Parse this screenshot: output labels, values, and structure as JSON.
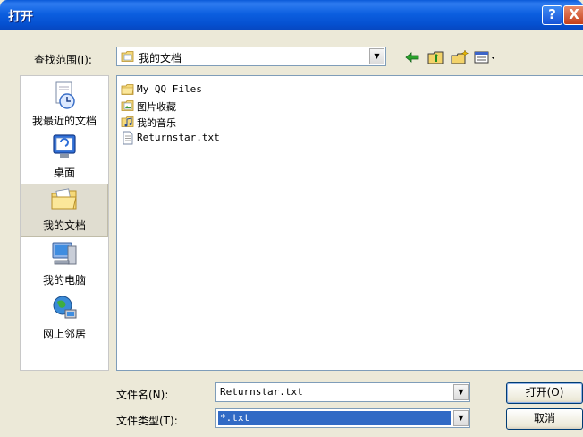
{
  "window": {
    "title": "打开",
    "help_glyph": "?",
    "close_glyph": "X"
  },
  "lookin": {
    "label": "查找范围(I):",
    "value": "我的文档",
    "dropdown_glyph": "▼"
  },
  "toolbar": {
    "icons": [
      "back-arrow-icon",
      "up-folder-icon",
      "new-folder-icon",
      "views-menu-icon"
    ]
  },
  "places": [
    {
      "label": "我最近的文档",
      "icon": "recent-documents-icon",
      "selected": false
    },
    {
      "label": "桌面",
      "icon": "desktop-icon",
      "selected": false
    },
    {
      "label": "我的文档",
      "icon": "my-documents-icon",
      "selected": true
    },
    {
      "label": "我的电脑",
      "icon": "my-computer-icon",
      "selected": false
    },
    {
      "label": "网上邻居",
      "icon": "network-places-icon",
      "selected": false
    }
  ],
  "files": [
    {
      "name": "My QQ Files",
      "icon": "folder-icon"
    },
    {
      "name": "图片收藏",
      "icon": "my-pictures-folder-icon"
    },
    {
      "name": "我的音乐",
      "icon": "my-music-folder-icon"
    },
    {
      "name": "Returnstar.txt",
      "icon": "text-file-icon"
    }
  ],
  "filename": {
    "label": "文件名(N):",
    "value": "Returnstar.txt"
  },
  "filetype": {
    "label": "文件类型(T):",
    "value": "*.txt"
  },
  "buttons": {
    "open": "打开(O)",
    "cancel": "取消"
  },
  "colors": {
    "title_bar": "#0550d0",
    "selection": "#316ac5",
    "dialog_bg": "#ece9d8"
  }
}
